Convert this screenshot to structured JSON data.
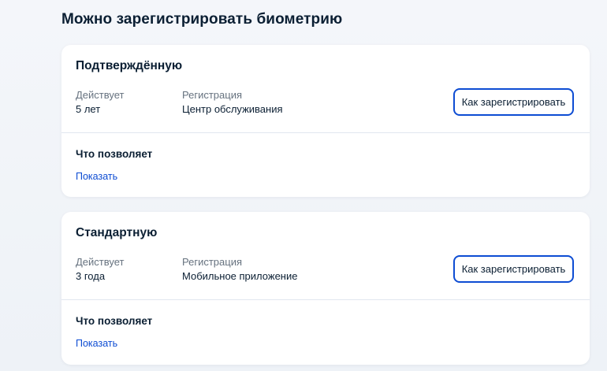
{
  "page": {
    "title": "Можно зарегистрировать биометрию"
  },
  "colors": {
    "accent": "#0d4cd3",
    "text": "#0b1f33",
    "muted": "#66727f",
    "background": "#eef2f7",
    "card": "#ffffff"
  },
  "cards": [
    {
      "title": "Подтверждённую",
      "valid_label": "Действует",
      "valid_value": "5 лет",
      "registration_label": "Регистрация",
      "registration_value": "Центр обслуживания",
      "button_label": "Как зарегистрировать",
      "allows_title": "Что позволяет",
      "show_link": "Показать"
    },
    {
      "title": "Стандартную",
      "valid_label": "Действует",
      "valid_value": "3 года",
      "registration_label": "Регистрация",
      "registration_value": "Мобильное приложение",
      "button_label": "Как зарегистрировать",
      "allows_title": "Что позволяет",
      "show_link": "Показать"
    }
  ]
}
